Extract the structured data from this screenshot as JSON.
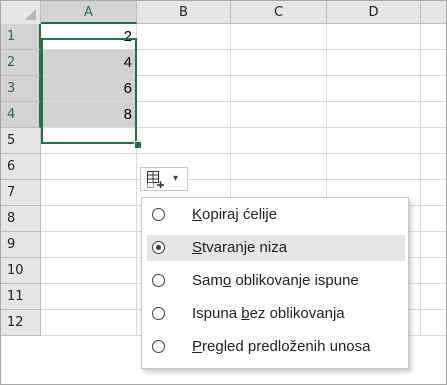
{
  "columns": [
    "A",
    "B",
    "C",
    "D"
  ],
  "rows": [
    "1",
    "2",
    "3",
    "4",
    "5",
    "6",
    "7",
    "8",
    "9",
    "10",
    "11",
    "12"
  ],
  "cells": {
    "A1": "2",
    "A2": "4",
    "A3": "6",
    "A4": "8"
  },
  "selection": {
    "range": "A1:A4",
    "accent_color": "#217346"
  },
  "autofill_options": {
    "button_icon": "auto-fill-options-icon",
    "caret_icon": "chevron-down-icon",
    "items": [
      {
        "label": "Kopiraj ćelije",
        "access_key": "K",
        "checked": false
      },
      {
        "label": "Stvaranje niza",
        "access_key": "S",
        "checked": true
      },
      {
        "label": "Samo oblikovanje ispune",
        "access_key": "o",
        "checked": false
      },
      {
        "label": "Ispuna bez oblikovanja",
        "access_key": "b",
        "checked": false
      },
      {
        "label": "Pregled predloženih unosa",
        "access_key": "P",
        "checked": false
      }
    ]
  }
}
